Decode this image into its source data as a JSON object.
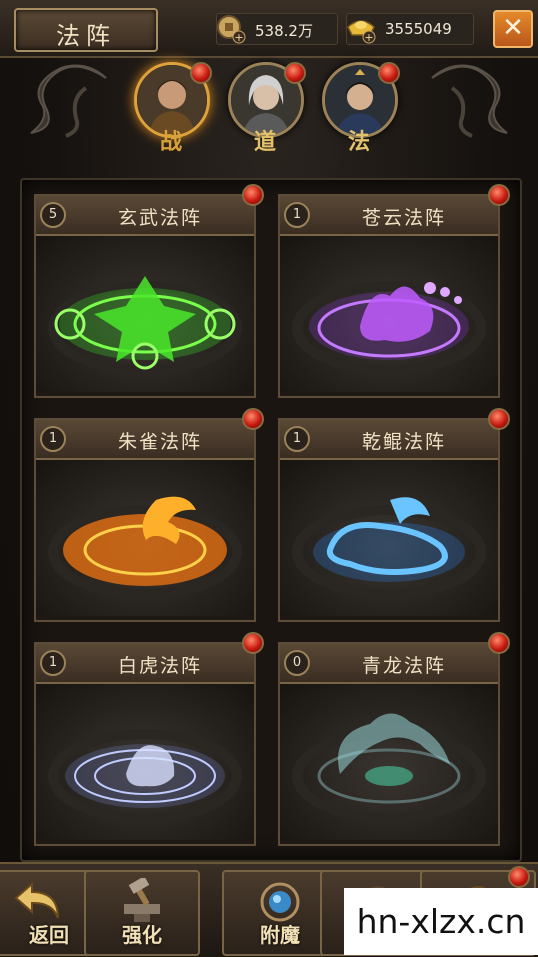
{
  "header": {
    "title": "法阵",
    "close_label": "✕"
  },
  "currency": {
    "coins": "538.2万",
    "ingots": "3555049"
  },
  "heroes": [
    {
      "label": "战",
      "color": "#d8a23a"
    },
    {
      "label": "道",
      "color": "#e2c26a"
    },
    {
      "label": "法",
      "color": "#e2c26a"
    }
  ],
  "formations": [
    {
      "level": "5",
      "name": "玄武法阵",
      "glow": "#5cff3a"
    },
    {
      "level": "1",
      "name": "苍云法阵",
      "glow": "#b05cff"
    },
    {
      "level": "1",
      "name": "朱雀法阵",
      "glow": "#ff8a1a"
    },
    {
      "level": "1",
      "name": "乾鲲法阵",
      "glow": "#3aa8ff"
    },
    {
      "level": "1",
      "name": "白虎法阵",
      "glow": "#a8b8ff"
    },
    {
      "level": "0",
      "name": "青龙法阵",
      "glow": "#8ad0d8"
    }
  ],
  "bottom_tabs": [
    {
      "label": "返回"
    },
    {
      "label": "强化"
    },
    {
      "label": "附魔"
    }
  ],
  "watermark": "hn-xlzx.cn"
}
